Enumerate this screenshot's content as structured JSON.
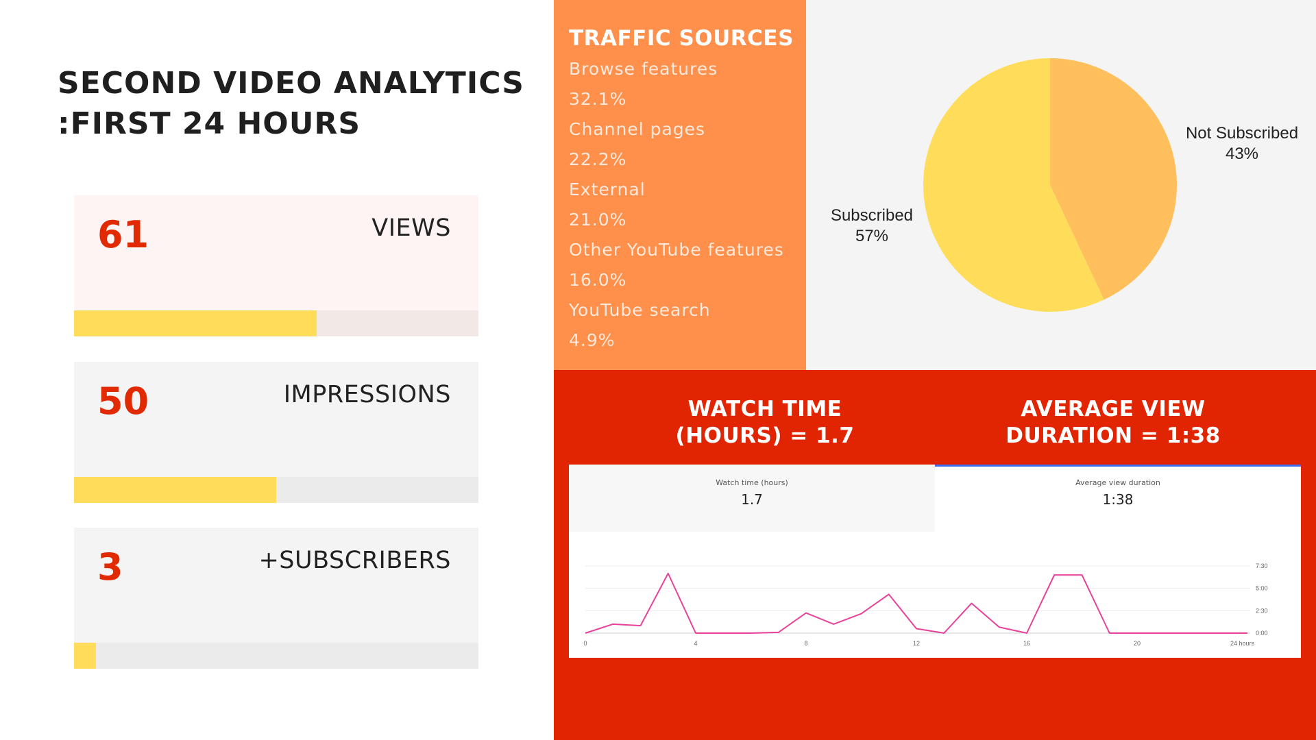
{
  "title": {
    "line1": "SECOND VIDEO ANALYTICS",
    "line2": ":FIRST 24 HOURS"
  },
  "metrics": [
    {
      "value": "61",
      "label": "VIEWS",
      "fill_fraction": 0.6
    },
    {
      "value": "50",
      "label": "IMPRESSIONS",
      "fill_fraction": 0.5
    },
    {
      "value": "3",
      "label": "+SUBSCRIBERS",
      "fill_fraction": 0.055
    }
  ],
  "traffic": {
    "title": "TRAFFIC SOURCES",
    "items": [
      {
        "name": "Browse features",
        "pct": "32.1%"
      },
      {
        "name": "Channel pages",
        "pct": "22.2%"
      },
      {
        "name": "External",
        "pct": "21.0%"
      },
      {
        "name": "Other YouTube features",
        "pct": "16.0%"
      },
      {
        "name": "YouTube search",
        "pct": "4.9%"
      }
    ]
  },
  "headers": {
    "watch": {
      "line1": "WATCH TIME",
      "line2": "(HOURS) = 1.7"
    },
    "avg": {
      "line1": "AVERAGE VIEW",
      "line2": "DURATION = 1:38"
    }
  },
  "tabs": {
    "watch": {
      "label": "Watch time (hours)",
      "value": "1.7"
    },
    "avg": {
      "label": "Average view duration",
      "value": "1:38"
    }
  },
  "colors": {
    "subscribed": "#ffdc5a",
    "not_subscribed": "#ffbf5c",
    "line": "#e8419a",
    "accent_red": "#e12401",
    "accent_orange": "#ff904b"
  },
  "chart_data": [
    {
      "type": "pie",
      "slices": [
        {
          "name": "Subscribed",
          "value": 57,
          "label": "57%"
        },
        {
          "name": "Not Subscribed",
          "value": 43,
          "label": "43%"
        }
      ]
    },
    {
      "type": "line",
      "x": [
        0,
        1,
        2,
        3,
        4,
        5,
        6,
        7,
        8,
        9,
        10,
        11,
        12,
        13,
        14,
        15,
        16,
        17,
        18,
        19,
        20,
        21,
        22,
        23,
        24
      ],
      "x_ticks": [
        "0",
        "4",
        "8",
        "12",
        "16",
        "20",
        "24 hours"
      ],
      "x_tick_values": [
        0,
        4,
        8,
        12,
        16,
        20,
        24
      ],
      "y_ticks": [
        "0:00",
        "2:30",
        "5:00",
        "7:30"
      ],
      "y_tick_seconds": [
        0,
        150,
        300,
        450
      ],
      "y_seconds": [
        0,
        60,
        50,
        400,
        0,
        0,
        0,
        5,
        135,
        60,
        130,
        260,
        30,
        0,
        200,
        40,
        0,
        390,
        390,
        0,
        0,
        0,
        0,
        0,
        0
      ],
      "ylim_seconds": [
        0,
        450
      ],
      "grid": true
    }
  ]
}
